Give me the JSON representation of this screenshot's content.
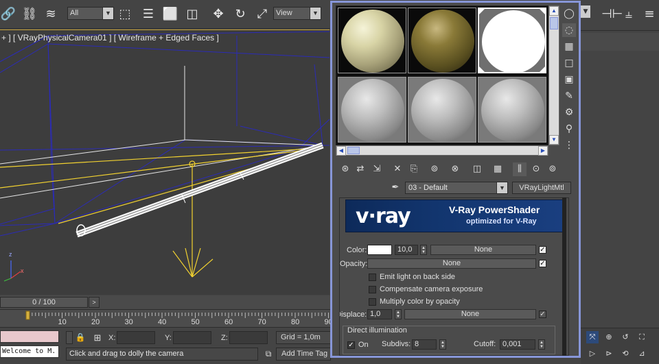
{
  "toolbar": {
    "filter_select": "All",
    "refcoord_select": "View",
    "icons": [
      "link-icon",
      "unlink-icon",
      "bind-spacewarp-icon",
      "select-object-icon",
      "select-by-name-icon",
      "rect-region-icon",
      "window-crossing-icon",
      "move-icon",
      "rotate-icon",
      "scale-icon"
    ]
  },
  "viewport": {
    "label": "+ ] [ VRayPhysicalCamera01 ] [ Wireframe + Edged Faces ]",
    "axis_x": "x",
    "axis_z": "z"
  },
  "timeline": {
    "slider_text": "0 / 100",
    "next_label": ">",
    "tick_labels": [
      "10",
      "20",
      "30",
      "40",
      "50",
      "60",
      "70",
      "80",
      "90"
    ]
  },
  "status": {
    "listener_text": "Welcome to M.",
    "x_label": "X:",
    "y_label": "Y:",
    "z_label": "Z:",
    "grid": "Grid = 1,0m",
    "prompt": "Click and drag to dolly the camera",
    "add_time_tag": "Add Time Tag"
  },
  "material_editor": {
    "slots": [
      {
        "name": "slot-1",
        "style": "marble",
        "active": false,
        "dark_bg": true
      },
      {
        "name": "slot-2",
        "style": "olive",
        "active": false,
        "dark_bg": true
      },
      {
        "name": "slot-3",
        "style": "white",
        "active": true,
        "dark_bg": false
      },
      {
        "name": "slot-4",
        "style": "grey",
        "active": false,
        "dark_bg": false
      },
      {
        "name": "slot-5",
        "style": "grey",
        "active": false,
        "dark_bg": false
      },
      {
        "name": "slot-6",
        "style": "grey",
        "active": false,
        "dark_bg": false
      }
    ],
    "material_name": "03 - Default",
    "material_type": "VRayLightMtl",
    "banner": {
      "logo": "v·ray",
      "title": "V-Ray PowerShader",
      "subtitle": "optimized for V-Ray"
    },
    "params": {
      "color_label": "Color:",
      "color_value": "10,0",
      "color_map": "None",
      "opacity_label": "Opacity:",
      "opacity_map": "None",
      "emit_back": "Emit light on back side",
      "compensate": "Compensate camera exposure",
      "multiply": "Multiply color by opacity",
      "displace_label": "Displace:",
      "displace_value": "1,0",
      "displace_map": "None",
      "direct_group": "Direct illumination",
      "on_label": "On",
      "subdivs_label": "Subdivs:",
      "subdivs_value": "8",
      "cutoff_label": "Cutoff:",
      "cutoff_value": "0,001"
    }
  },
  "colors": {
    "editor_border": "#8796d8",
    "wire_yellow": "#f2d230",
    "wire_blue": "#2b2bb8",
    "banner_blue": "#12356e"
  }
}
